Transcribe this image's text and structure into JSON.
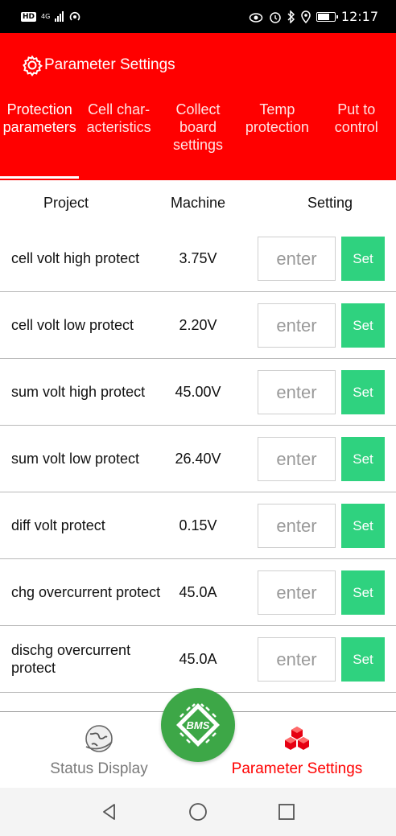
{
  "status_bar": {
    "hd": "HD",
    "network": "4G",
    "time": "12:17",
    "icons": [
      "eye-icon",
      "alarm-icon",
      "bluetooth-icon",
      "location-icon",
      "battery-icon"
    ]
  },
  "header": {
    "title": "Parameter Settings",
    "title_icon": "gear-icon",
    "background": "#ff0000"
  },
  "tabs": [
    {
      "label": "Protection\nparameters",
      "active": true
    },
    {
      "label": "Cell char-\nacteristics",
      "active": false
    },
    {
      "label": "Collect\nboard\nsettings",
      "active": false
    },
    {
      "label": "Temp\nprotection",
      "active": false
    },
    {
      "label": "Put to\ncontrol",
      "active": false
    }
  ],
  "table": {
    "headers": {
      "project": "Project",
      "machine": "Machine",
      "setting": "Setting"
    },
    "input_placeholder": "enter",
    "set_label": "Set",
    "set_color": "#2fd27f",
    "rows": [
      {
        "name": "cell volt high protect",
        "value": "3.75V"
      },
      {
        "name": "cell volt low protect",
        "value": "2.20V"
      },
      {
        "name": "sum volt high protect",
        "value": "45.00V"
      },
      {
        "name": "sum volt low protect",
        "value": "26.40V"
      },
      {
        "name": "diff volt protect",
        "value": "0.15V"
      },
      {
        "name": "chg overcurrent protect",
        "value": "45.0A"
      },
      {
        "name": "dischg overcurrent protect",
        "value": "45.0A"
      }
    ]
  },
  "bottom_nav": {
    "status": {
      "label": "Status Display",
      "icon": "globe-icon"
    },
    "center": {
      "label": "BMS",
      "icon": "bms-chip-icon",
      "color": "#3da747"
    },
    "param": {
      "label": "Parameter Settings",
      "icon": "cubes-icon",
      "color": "#ff0000"
    }
  },
  "system_nav": {
    "icons": [
      "back-icon",
      "home-icon",
      "recents-icon"
    ]
  }
}
